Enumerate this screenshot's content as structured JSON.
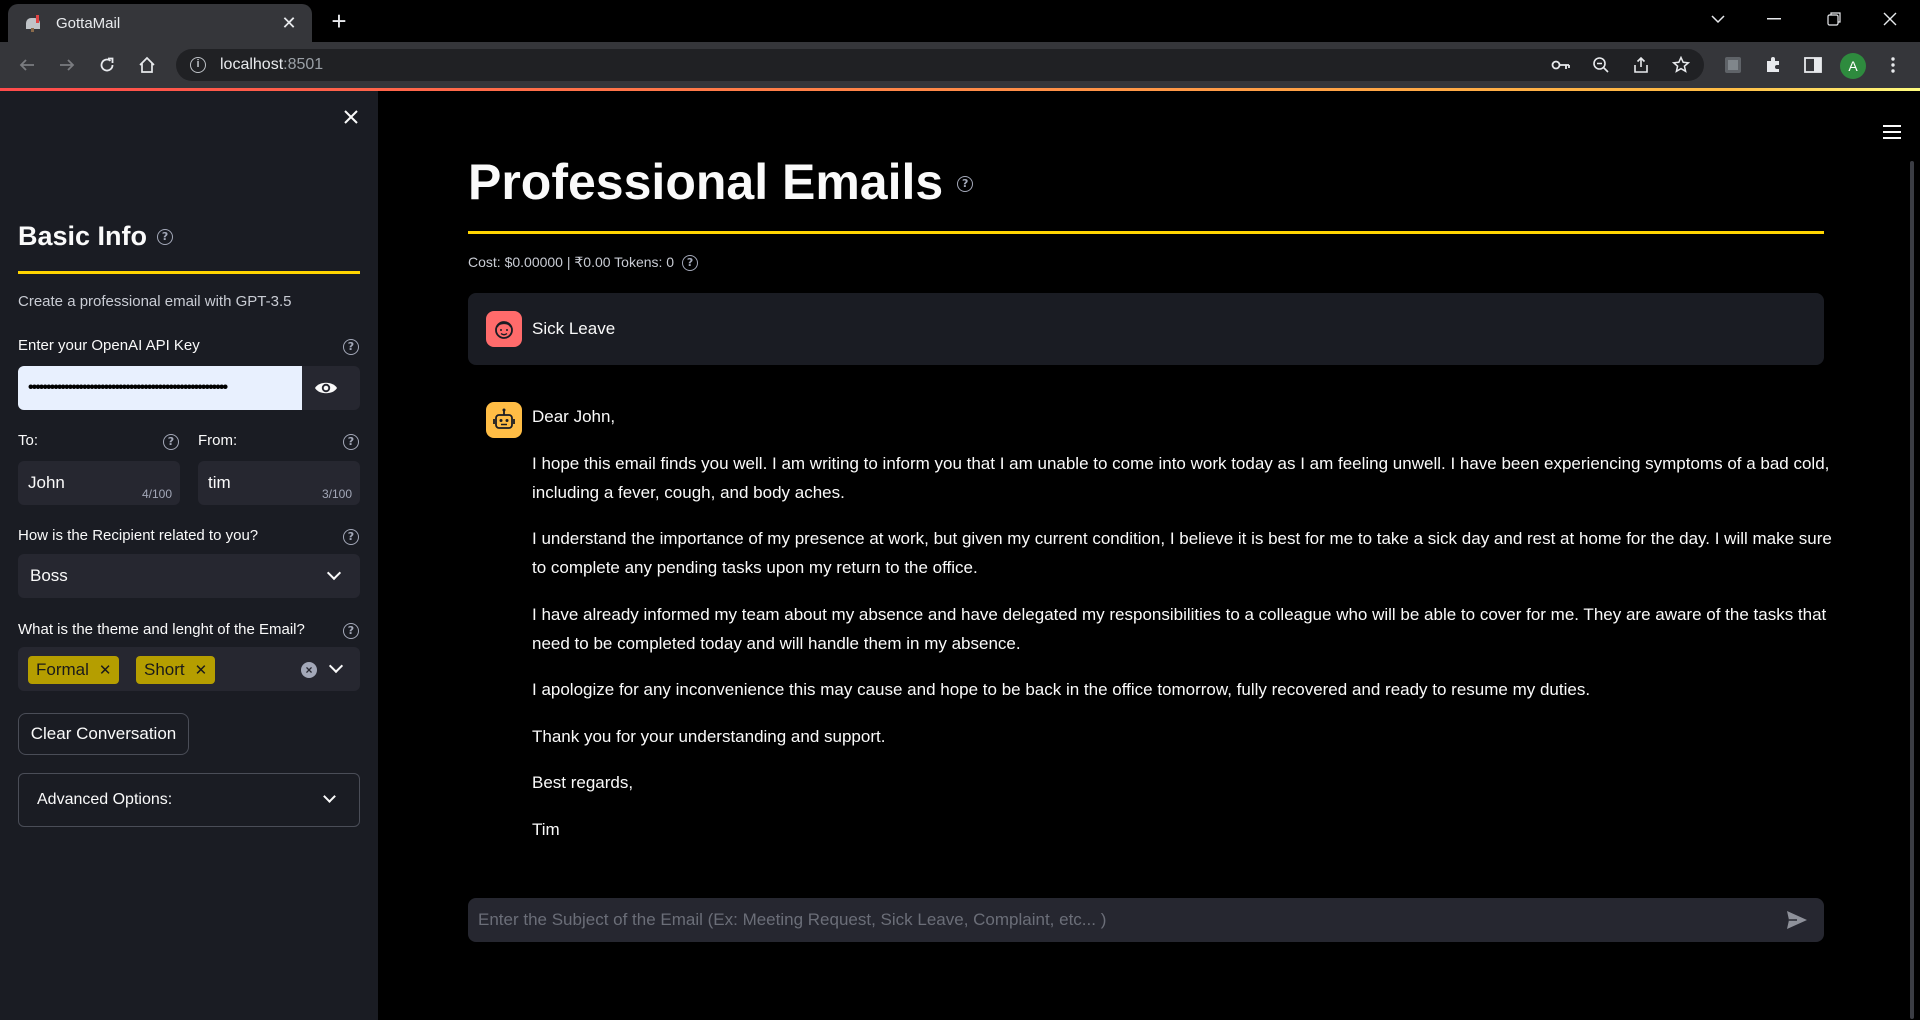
{
  "browser": {
    "tab_title": "GottaMail",
    "url_host": "localhost",
    "url_port": ":8501",
    "avatar_letter": "A"
  },
  "sidebar": {
    "title": "Basic Info",
    "subtitle": "Create a professional email with GPT-3.5",
    "api_key_label": "Enter your OpenAI API Key",
    "api_key_value": "•••••••••••••••••••••••••••••••••••••••••••••••••••••••",
    "to_label": "To:",
    "to_value": "John",
    "to_counter": "4/100",
    "from_label": "From:",
    "from_value": "tim",
    "from_counter": "3/100",
    "relation_label": "How is the Recipient related to you?",
    "relation_value": "Boss",
    "theme_label": "What is the theme and lenght of the Email?",
    "theme_chips": [
      "Formal",
      "Short"
    ],
    "clear_button": "Clear Conversation",
    "advanced_label": "Advanced Options:"
  },
  "main": {
    "title": "Professional Emails",
    "cost_line": "Cost: $0.00000 | ₹0.00 Tokens: 0",
    "user_message": "Sick Leave",
    "assistant_message": [
      "Dear John,",
      "I hope this email finds you well. I am writing to inform you that I am unable to come into work today as I am feeling unwell. I have been experiencing symptoms of a bad cold, including a fever, cough, and body aches.",
      "I understand the importance of my presence at work, but given my current condition, I believe it is best for me to take a sick day and rest at home for the day. I will make sure to complete any pending tasks upon my return to the office.",
      "I have already informed my team about my absence and have delegated my responsibilities to a colleague who will be able to cover for me. They are aware of the tasks that need to be completed today and will handle them in my absence.",
      "I apologize for any inconvenience this may cause and hope to be back in the office tomorrow, fully recovered and ready to resume my duties.",
      "Thank you for your understanding and support.",
      "Best regards,",
      "Tim"
    ],
    "chat_placeholder": "Enter the Subject of the Email (Ex: Meeting Request, Sick Leave, Complaint, etc... )"
  },
  "colors": {
    "accent_yellow": "#ffd500",
    "chip_bg": "#b59e00",
    "sidebar_bg": "#1a1c23",
    "input_bg": "#262730",
    "user_avatar": "#ff6b6b",
    "bot_avatar": "#ffbd45"
  }
}
